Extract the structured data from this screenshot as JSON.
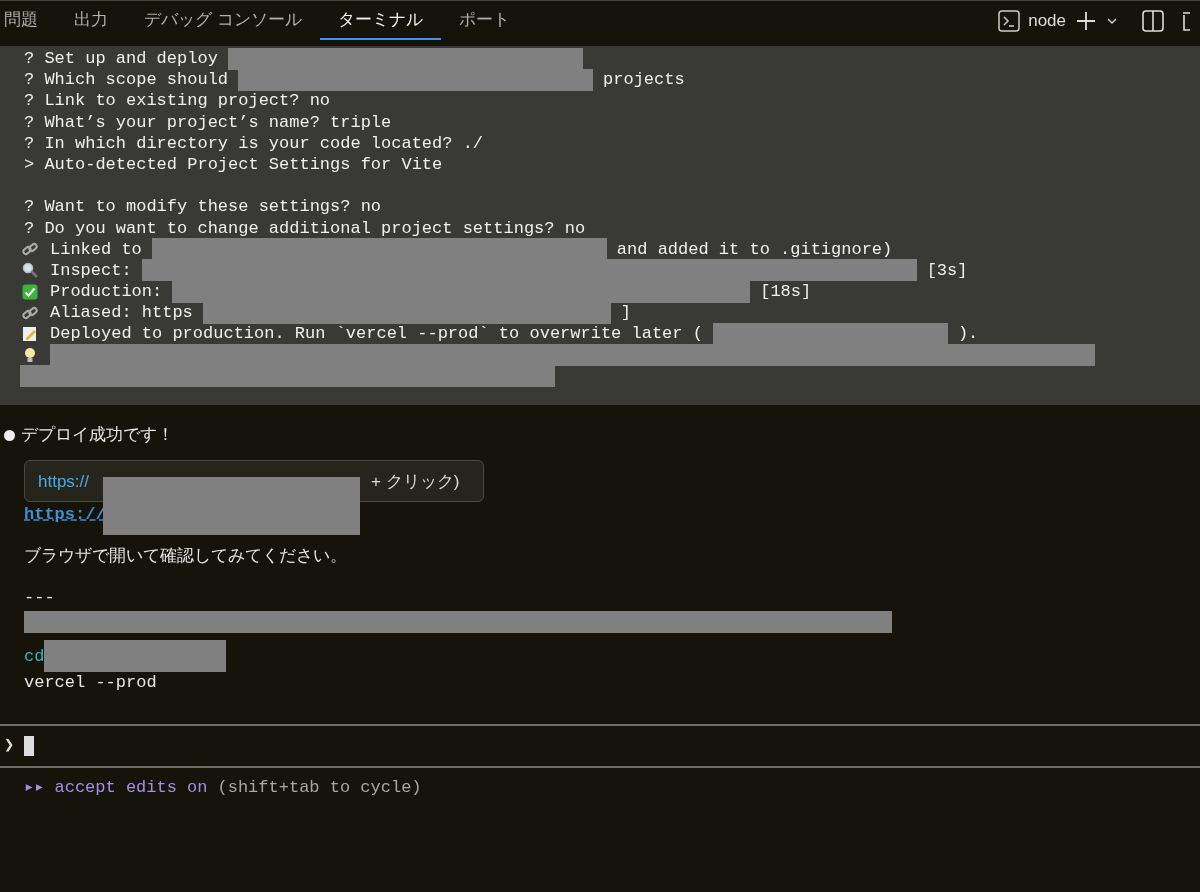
{
  "tabs": [
    {
      "label": "問題",
      "selected": false
    },
    {
      "label": "出力",
      "selected": false
    },
    {
      "label": "デバッグ コンソール",
      "selected": false
    },
    {
      "label": "ターミナル",
      "selected": true
    },
    {
      "label": "ポート",
      "selected": false
    }
  ],
  "terminal_name": "node",
  "output_lines": [
    {
      "kind": "plain",
      "segments": [
        {
          "text": "? Set up and deploy"
        },
        {
          "kind": "redacted"
        }
      ]
    },
    {
      "kind": "plain",
      "segments": [
        {
          "text": "? Which scope should"
        },
        {
          "kind": "redacted"
        },
        {
          "text": "projects"
        }
      ]
    },
    {
      "kind": "plain",
      "segments": [
        {
          "text": "? Link to existing project? no"
        }
      ]
    },
    {
      "kind": "plain",
      "segments": [
        {
          "text": "? What’s your project’s name? triple"
        }
      ]
    },
    {
      "kind": "plain",
      "segments": [
        {
          "text": "? In which directory is your code located? ./"
        }
      ]
    },
    {
      "kind": "plain",
      "segments": [
        {
          "text": "> Auto-detected Project Settings for Vite"
        }
      ]
    },
    {
      "kind": "blank"
    },
    {
      "kind": "plain",
      "segments": [
        {
          "text": "? Want to modify these settings? no"
        }
      ]
    },
    {
      "kind": "plain",
      "segments": [
        {
          "text": "? Do you want to change additional project settings? no"
        }
      ]
    },
    {
      "kind": "link",
      "segments": [
        {
          "text": "Linked to"
        },
        {
          "kind": "redacted"
        },
        {
          "text": "and added it to .gitignore)"
        }
      ]
    },
    {
      "kind": "inspect",
      "segments": [
        {
          "text": "Inspect:"
        },
        {
          "kind": "redacted"
        },
        {
          "text": "[3s]"
        }
      ]
    },
    {
      "kind": "check",
      "segments": [
        {
          "text": "Production:"
        },
        {
          "kind": "redacted"
        },
        {
          "text": "[18s]"
        }
      ]
    },
    {
      "kind": "link",
      "segments": [
        {
          "text": "Aliased: https"
        },
        {
          "kind": "redacted"
        },
        {
          "text": "]"
        }
      ]
    },
    {
      "kind": "memo",
      "segments": [
        {
          "text": "Deployed to production. Run `vercel --prod` to overwrite later ("
        },
        {
          "kind": "redacted"
        },
        {
          "text": ")."
        }
      ]
    },
    {
      "kind": "bulb",
      "segments": [
        {
          "kind": "redacted"
        }
      ]
    },
    {
      "kind": "wrap",
      "segments": [
        {
          "kind": "redacted"
        }
      ]
    }
  ],
  "message": {
    "title": "デプロイ成功です！",
    "tooltip": {
      "link": "https://",
      "suffix": "+ クリック)"
    },
    "link": "https://",
    "note": "ブラウザで開いて確認してみてください。",
    "separator": "---",
    "command": "cd",
    "command_2": "vercel --prod"
  },
  "prompt": {
    "symbol": "❯"
  },
  "mode": {
    "arrows": "▸▸",
    "label": "accept edits on",
    "hint": "(shift+tab to cycle)"
  }
}
